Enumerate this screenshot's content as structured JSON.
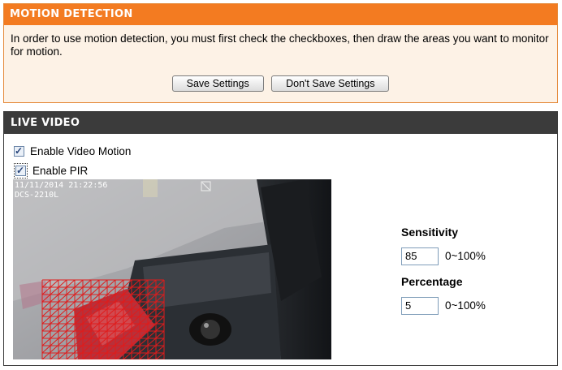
{
  "motion_detection": {
    "title": "MOTION DETECTION",
    "instructions": "In order to use motion detection, you must first check the checkboxes, then draw the areas you want to monitor for motion.",
    "save_label": "Save Settings",
    "dont_save_label": "Don't Save Settings"
  },
  "live_video": {
    "title": "LIVE VIDEO",
    "enable_video_motion": {
      "label": "Enable Video Motion",
      "checked": true
    },
    "enable_pir": {
      "label": "Enable PIR",
      "checked": true
    },
    "osd_line1": "11/11/2014 21:22:56",
    "osd_line2": "DCS-2210L",
    "sensitivity": {
      "label": "Sensitivity",
      "value": "85",
      "range": "0~100%"
    },
    "percentage": {
      "label": "Percentage",
      "value": "5",
      "range": "0~100%"
    }
  },
  "colors": {
    "header_orange": "#f37b21",
    "panel_bg": "#fdf2e6",
    "header_dark": "#3b3b3b",
    "motion_grid": "#e01b1b"
  }
}
